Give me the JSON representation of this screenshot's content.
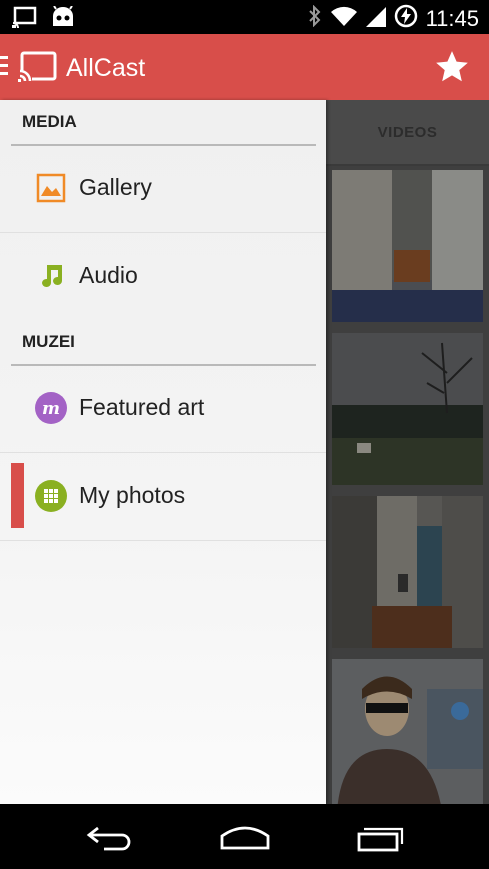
{
  "status_bar": {
    "time": "11:45",
    "icons": [
      "cast-notification-icon",
      "android-robot-icon",
      "bluetooth-icon",
      "wifi-icon",
      "signal-icon",
      "battery-charging-icon"
    ]
  },
  "app_bar": {
    "title": "AllCast",
    "icons": [
      "menu-icon",
      "cast-logo-icon",
      "star-icon"
    ]
  },
  "drawer": {
    "sections": [
      {
        "title": "MEDIA",
        "items": [
          {
            "label": "Gallery",
            "icon": "gallery-icon"
          },
          {
            "label": "Audio",
            "icon": "music-note-icon"
          }
        ]
      },
      {
        "title": "MUZEI",
        "items": [
          {
            "label": "Featured art",
            "icon": "muzei-icon"
          },
          {
            "label": "My photos",
            "icon": "grid-icon",
            "selected": true
          }
        ]
      }
    ]
  },
  "content": {
    "tab_label": "VIDEOS",
    "thumbnails": [
      "photo-thumbnail",
      "photo-thumbnail",
      "photo-thumbnail",
      "photo-thumbnail"
    ]
  },
  "nav_bar": {
    "buttons": [
      "back-icon",
      "home-icon",
      "recents-icon"
    ]
  },
  "colors": {
    "accent": "#d84e4a",
    "gallery_icon": "#f08a26",
    "audio_icon": "#8ab021",
    "muzei_icon": "#a362c5",
    "photos_icon": "#8ab021"
  }
}
